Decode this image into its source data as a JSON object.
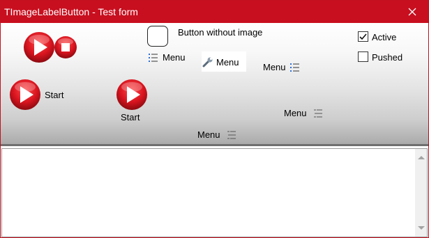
{
  "window": {
    "title": "TImageLabelButton - Test form"
  },
  "buttons": {
    "start_left": "Start",
    "start_center": "Start",
    "no_image": "Button without image",
    "menu_1": "Menu",
    "menu_2": "Menu",
    "menu_3": "Menu",
    "menu_4": "Menu",
    "menu_5": "Menu"
  },
  "checkboxes": {
    "active": {
      "label": "Active",
      "checked": true
    },
    "pushed": {
      "label": "Pushed",
      "checked": false
    }
  },
  "memo": {
    "text": ""
  },
  "colors": {
    "titlebar": "#c80f1f",
    "play_red": "#d8141f"
  },
  "icons": [
    "play-icon",
    "stop-icon",
    "menu-list-icon",
    "wrench-icon",
    "close-icon",
    "check-icon"
  ]
}
